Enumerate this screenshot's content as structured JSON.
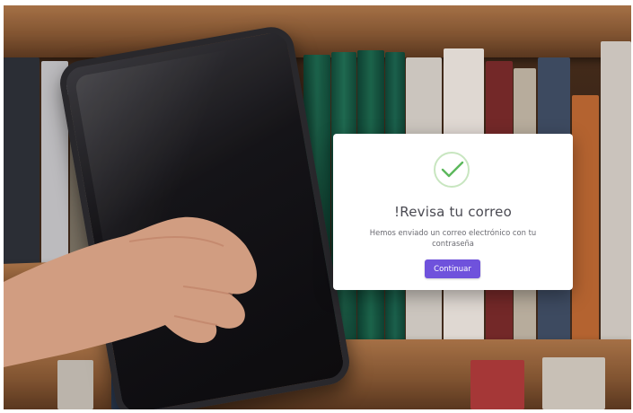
{
  "modal": {
    "icon": "checkmark-circle-icon",
    "title": "!Revisa tu correo",
    "message": "Hemos enviado un correo electrónico con tu contraseña",
    "button_label": "Continuar"
  },
  "colors": {
    "accent": "#6f52dc",
    "success": "#5cb85c",
    "success_ring": "#c8e6c0",
    "title_text": "#4a4a52",
    "body_text": "#6b6b72"
  }
}
